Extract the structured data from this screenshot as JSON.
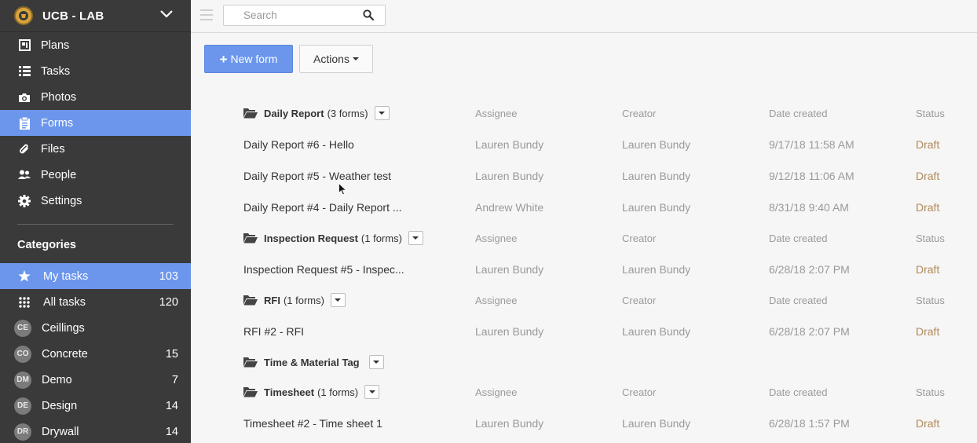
{
  "sidebar": {
    "brand": "UCB - LAB",
    "nav": [
      {
        "label": "Plans",
        "icon": "plans-icon"
      },
      {
        "label": "Tasks",
        "icon": "tasks-icon"
      },
      {
        "label": "Photos",
        "icon": "camera-icon"
      },
      {
        "label": "Forms",
        "icon": "forms-icon",
        "active": true
      },
      {
        "label": "Files",
        "icon": "paperclip-icon"
      },
      {
        "label": "People",
        "icon": "people-icon"
      },
      {
        "label": "Settings",
        "icon": "gear-icon"
      }
    ],
    "categories_title": "Categories",
    "categories": [
      {
        "label": "My tasks",
        "count": "103",
        "icon": "star-icon",
        "active": true
      },
      {
        "label": "All tasks",
        "count": "120",
        "icon": "grid-icon"
      },
      {
        "label": "Ceillings",
        "count": "",
        "badge": "CE"
      },
      {
        "label": "Concrete",
        "count": "15",
        "badge": "CO"
      },
      {
        "label": "Demo",
        "count": "7",
        "badge": "DM"
      },
      {
        "label": "Design",
        "count": "14",
        "badge": "DE"
      },
      {
        "label": "Drywall",
        "count": "14",
        "badge": "DR"
      }
    ]
  },
  "topbar": {
    "search_placeholder": "Search"
  },
  "toolbar": {
    "new_form_label": "New form",
    "actions_label": "Actions"
  },
  "columns": {
    "assignee": "Assignee",
    "creator": "Creator",
    "date_created": "Date created",
    "status": "Status"
  },
  "groups": {
    "daily": {
      "name": "Daily Report",
      "count": "(3 forms)"
    },
    "inspection": {
      "name": "Inspection Request",
      "count": "(1 forms)"
    },
    "rfi": {
      "name": "RFI",
      "count": "(1 forms)"
    },
    "tm": {
      "name": "Time & Material Tag",
      "count": ""
    },
    "timesheet": {
      "name": "Timesheet",
      "count": "(1 forms)"
    }
  },
  "forms": {
    "daily_6": {
      "name": "Daily Report #6 - Hello",
      "assignee": "Lauren Bundy",
      "creator": "Lauren Bundy",
      "date": "9/17/18 11:58 AM",
      "status": "Draft"
    },
    "daily_5": {
      "name": "Daily Report #5 - Weather test",
      "assignee": "Lauren Bundy",
      "creator": "Lauren Bundy",
      "date": "9/12/18 11:06 AM",
      "status": "Draft"
    },
    "daily_4": {
      "name": "Daily Report #4 - Daily Report ...",
      "assignee": "Andrew White",
      "creator": "Lauren Bundy",
      "date": "8/31/18 9:40 AM",
      "status": "Draft"
    },
    "inspection_5": {
      "name": "Inspection Request #5 - Inspec...",
      "assignee": "Lauren Bundy",
      "creator": "Lauren Bundy",
      "date": "6/28/18 2:07 PM",
      "status": "Draft"
    },
    "rfi_2": {
      "name": "RFI #2 - RFI",
      "assignee": "Lauren Bundy",
      "creator": "Lauren Bundy",
      "date": "6/28/18 2:07 PM",
      "status": "Draft"
    },
    "timesheet_2": {
      "name": "Timesheet #2 - Time sheet 1",
      "assignee": "Lauren Bundy",
      "creator": "Lauren Bundy",
      "date": "6/28/18 1:57 PM",
      "status": "Draft"
    }
  },
  "colors": {
    "accent": "#6b96ec",
    "sidebar_bg": "#3a3a3a",
    "draft": "#b08a5a"
  }
}
